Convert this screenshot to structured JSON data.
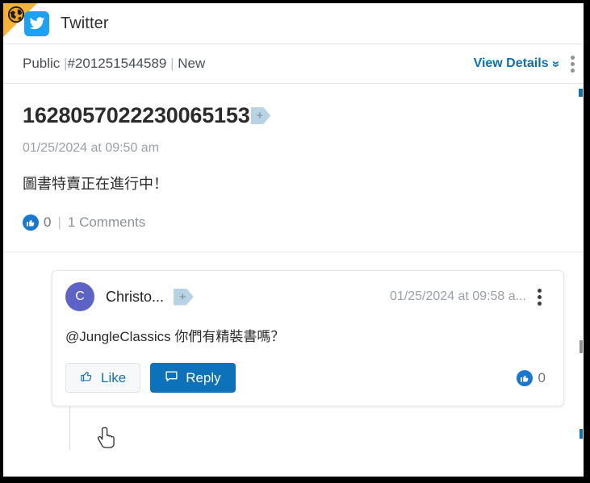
{
  "header": {
    "channel_name": "Twitter",
    "globe_icon": "globe-icon",
    "platform_icon": "twitter-bird-icon",
    "ribbon_color": "#f9b233",
    "twitter_blue": "#1da1f2"
  },
  "meta": {
    "visibility": "Public",
    "separator_1": " |",
    "case_id": "#201251544589",
    "separator_2": " | ",
    "status": "New",
    "view_details_label": "View Details",
    "chevron_icon": "chevron-down-icon",
    "kebab_icon": "more-options-icon"
  },
  "post": {
    "id": "1628057022230065153",
    "tag_badge_label": "+",
    "timestamp": "01/25/2024 at 09:50 am",
    "text": "圖書特賣正在進行中！",
    "like_icon": "thumbs-up-filled-icon",
    "like_count": "0",
    "stat_divider": "|",
    "comments_label": "1 Comments"
  },
  "comment": {
    "avatar_initial": "C",
    "author": "Christo...",
    "tag_badge_label": "+",
    "timestamp": "01/25/2024 at 09:58 a...",
    "kebab_icon": "more-options-icon",
    "text": "@JungleClassics 你們有精裝書嗎？",
    "like_button_label": "Like",
    "like_button_icon": "thumbs-up-outline-icon",
    "reply_button_label": "Reply",
    "reply_button_icon": "speech-bubble-icon",
    "like_stat_icon": "thumbs-up-filled-icon",
    "like_stat_count": "0"
  },
  "colors": {
    "accent_blue": "#0d72b9",
    "link_blue": "#0d6fb8",
    "avatar_purple": "#5d63c4",
    "tag_blue": "#b7d3e4",
    "muted_gray": "#9aa0a6"
  },
  "cursor": {
    "icon": "hand-pointer-cursor"
  }
}
